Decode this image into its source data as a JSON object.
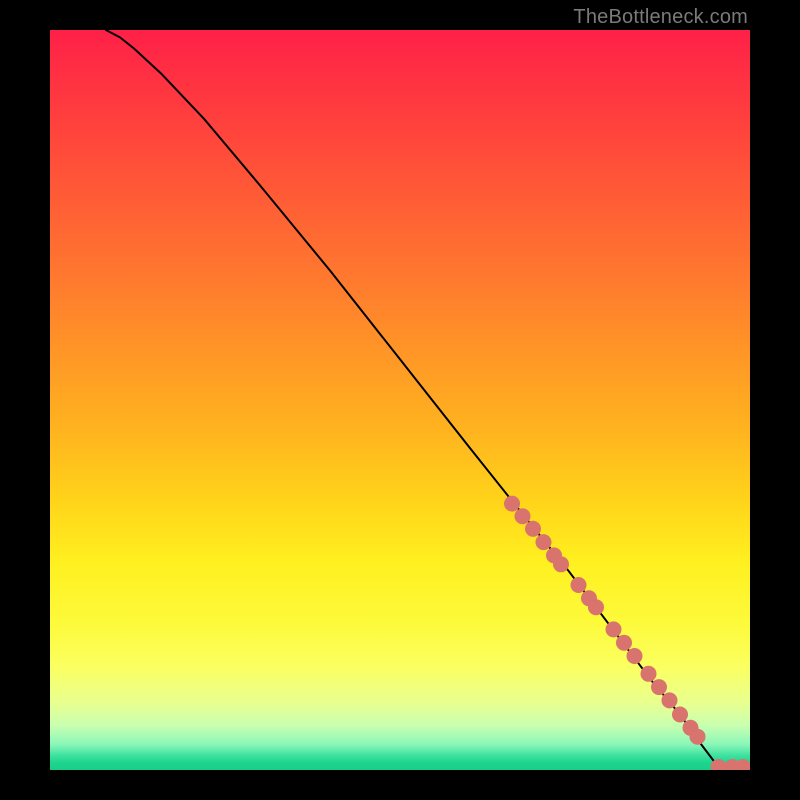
{
  "watermark": "TheBottleneck.com",
  "colors": {
    "marker": "#d9736e",
    "line": "#000000"
  },
  "chart_data": {
    "type": "line",
    "title": "",
    "xlabel": "",
    "ylabel": "",
    "xlim": [
      0,
      100
    ],
    "ylim": [
      0,
      100
    ],
    "grid": false,
    "legend": false,
    "note": "Axes are implicit (no tick labels visible). Curve is a bottleneck-style decreasing curve from top-left to bottom-right. Marker points highlight the lower-right segment.",
    "series": [
      {
        "name": "curve",
        "style": "line",
        "x": [
          8,
          10,
          12,
          16,
          22,
          30,
          40,
          50,
          60,
          68,
          74,
          80,
          86,
          90,
          93,
          95,
          97,
          100
        ],
        "y": [
          100,
          99,
          97.5,
          94,
          88,
          79,
          67.5,
          55.5,
          43.5,
          34,
          27,
          19.5,
          12,
          7.5,
          3.5,
          1,
          0.3,
          0.3
        ]
      },
      {
        "name": "highlight-points",
        "style": "markers",
        "x": [
          66,
          67.5,
          69,
          70.5,
          72,
          73,
          75.5,
          77,
          78,
          80.5,
          82,
          83.5,
          85.5,
          87,
          88.5,
          90,
          91.5,
          92.5,
          95.5,
          97.5,
          99
        ],
        "y": [
          36,
          34.3,
          32.6,
          30.8,
          29,
          27.8,
          25,
          23.2,
          22,
          19,
          17.2,
          15.4,
          13,
          11.2,
          9.4,
          7.5,
          5.7,
          4.5,
          0.4,
          0.4,
          0.4
        ]
      }
    ]
  }
}
